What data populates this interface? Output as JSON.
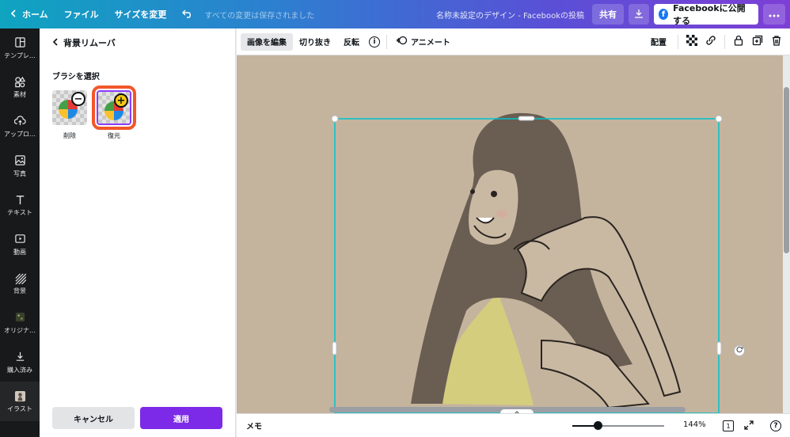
{
  "topbar": {
    "home_label": "ホーム",
    "file_label": "ファイル",
    "resize_label": "サイズを変更",
    "saved_status": "すべての変更は保存されました",
    "document_name": "名称未設定のデザイン - Facebookの投稿",
    "share_label": "共有",
    "publish_label": "Facebookに公開する",
    "fb_glyph": "f"
  },
  "leftnav": {
    "items": [
      {
        "label": "テンプレ…",
        "icon": "template-icon"
      },
      {
        "label": "素材",
        "icon": "elements-icon"
      },
      {
        "label": "アップロ…",
        "icon": "upload-icon"
      },
      {
        "label": "写真",
        "icon": "photo-icon"
      },
      {
        "label": "テキスト",
        "icon": "text-icon"
      },
      {
        "label": "動画",
        "icon": "video-icon"
      },
      {
        "label": "背景",
        "icon": "background-icon"
      },
      {
        "label": "オリジナ…",
        "icon": "original-icon"
      },
      {
        "label": "購入済み",
        "icon": "purchased-icon"
      },
      {
        "label": "イラスト",
        "icon": "illustration-icon"
      }
    ]
  },
  "panel": {
    "title": "背景リムーバ",
    "subtitle": "ブラシを選択",
    "brushes": {
      "erase_label": "削除",
      "restore_label": "復元",
      "erase_glyph": "−",
      "restore_glyph": "+"
    },
    "cancel_label": "キャンセル",
    "apply_label": "適用"
  },
  "context_toolbar": {
    "edit_image": "画像を編集",
    "crop": "切り抜き",
    "flip": "反転",
    "info_glyph": "i",
    "animate": "アニメート",
    "position": "配置"
  },
  "bottombar": {
    "memo": "メモ",
    "zoom_percent": 144,
    "zoom_display": "144%",
    "page_number": "1",
    "help_glyph": "?"
  },
  "colors": {
    "accent_purple": "#7d2ae8",
    "highlight_orange": "#f2572a",
    "selection_teal": "#00c4cc",
    "canvas_bg": "#c4b49e"
  }
}
